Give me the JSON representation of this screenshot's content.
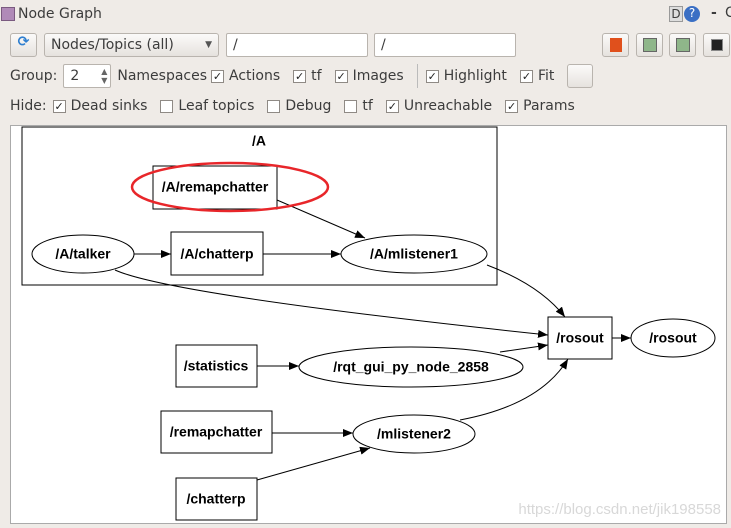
{
  "window": {
    "title": "Node Graph",
    "help_d": "D",
    "help_q": "?",
    "minimize": "-",
    "close": "C"
  },
  "toolbar": {
    "filter_mode": "Nodes/Topics (all)",
    "ns_filter": "/",
    "topic_filter": "/"
  },
  "options": {
    "group_label": "Group:",
    "group_value": "2",
    "items": [
      {
        "label": "Namespaces",
        "checked": false,
        "prefix_cb": false
      },
      {
        "label": "Actions",
        "checked": true
      },
      {
        "label": "tf",
        "checked": true
      },
      {
        "label": "Images",
        "checked": true
      },
      {
        "label": "Highlight",
        "checked": true
      },
      {
        "label": "Fit",
        "checked": true
      }
    ]
  },
  "hide": {
    "label": "Hide:",
    "items": [
      {
        "label": "Dead sinks",
        "checked": true
      },
      {
        "label": "Leaf topics",
        "checked": false
      },
      {
        "label": "Debug",
        "checked": false
      },
      {
        "label": "tf",
        "checked": false
      },
      {
        "label": "Unreachable",
        "checked": true
      },
      {
        "label": "Params",
        "checked": true
      }
    ]
  },
  "graph": {
    "cluster": "/A",
    "nodes": {
      "a_remapchatter": "/A/remapchatter",
      "a_talker": "/A/talker",
      "a_chatterp": "/A/chatterp",
      "a_mlistener1": "/A/mlistener1",
      "rosout_node": "/rosout",
      "rosout_topic": "/rosout",
      "statistics": "/statistics",
      "rqt": "/rqt_gui_py_node_2858",
      "remapchatter": "/remapchatter",
      "mlistener2": "/mlistener2",
      "chatterp": "/chatterp"
    },
    "highlight_color": "#e8262a"
  },
  "watermark": "https://blog.csdn.net/jik198558"
}
